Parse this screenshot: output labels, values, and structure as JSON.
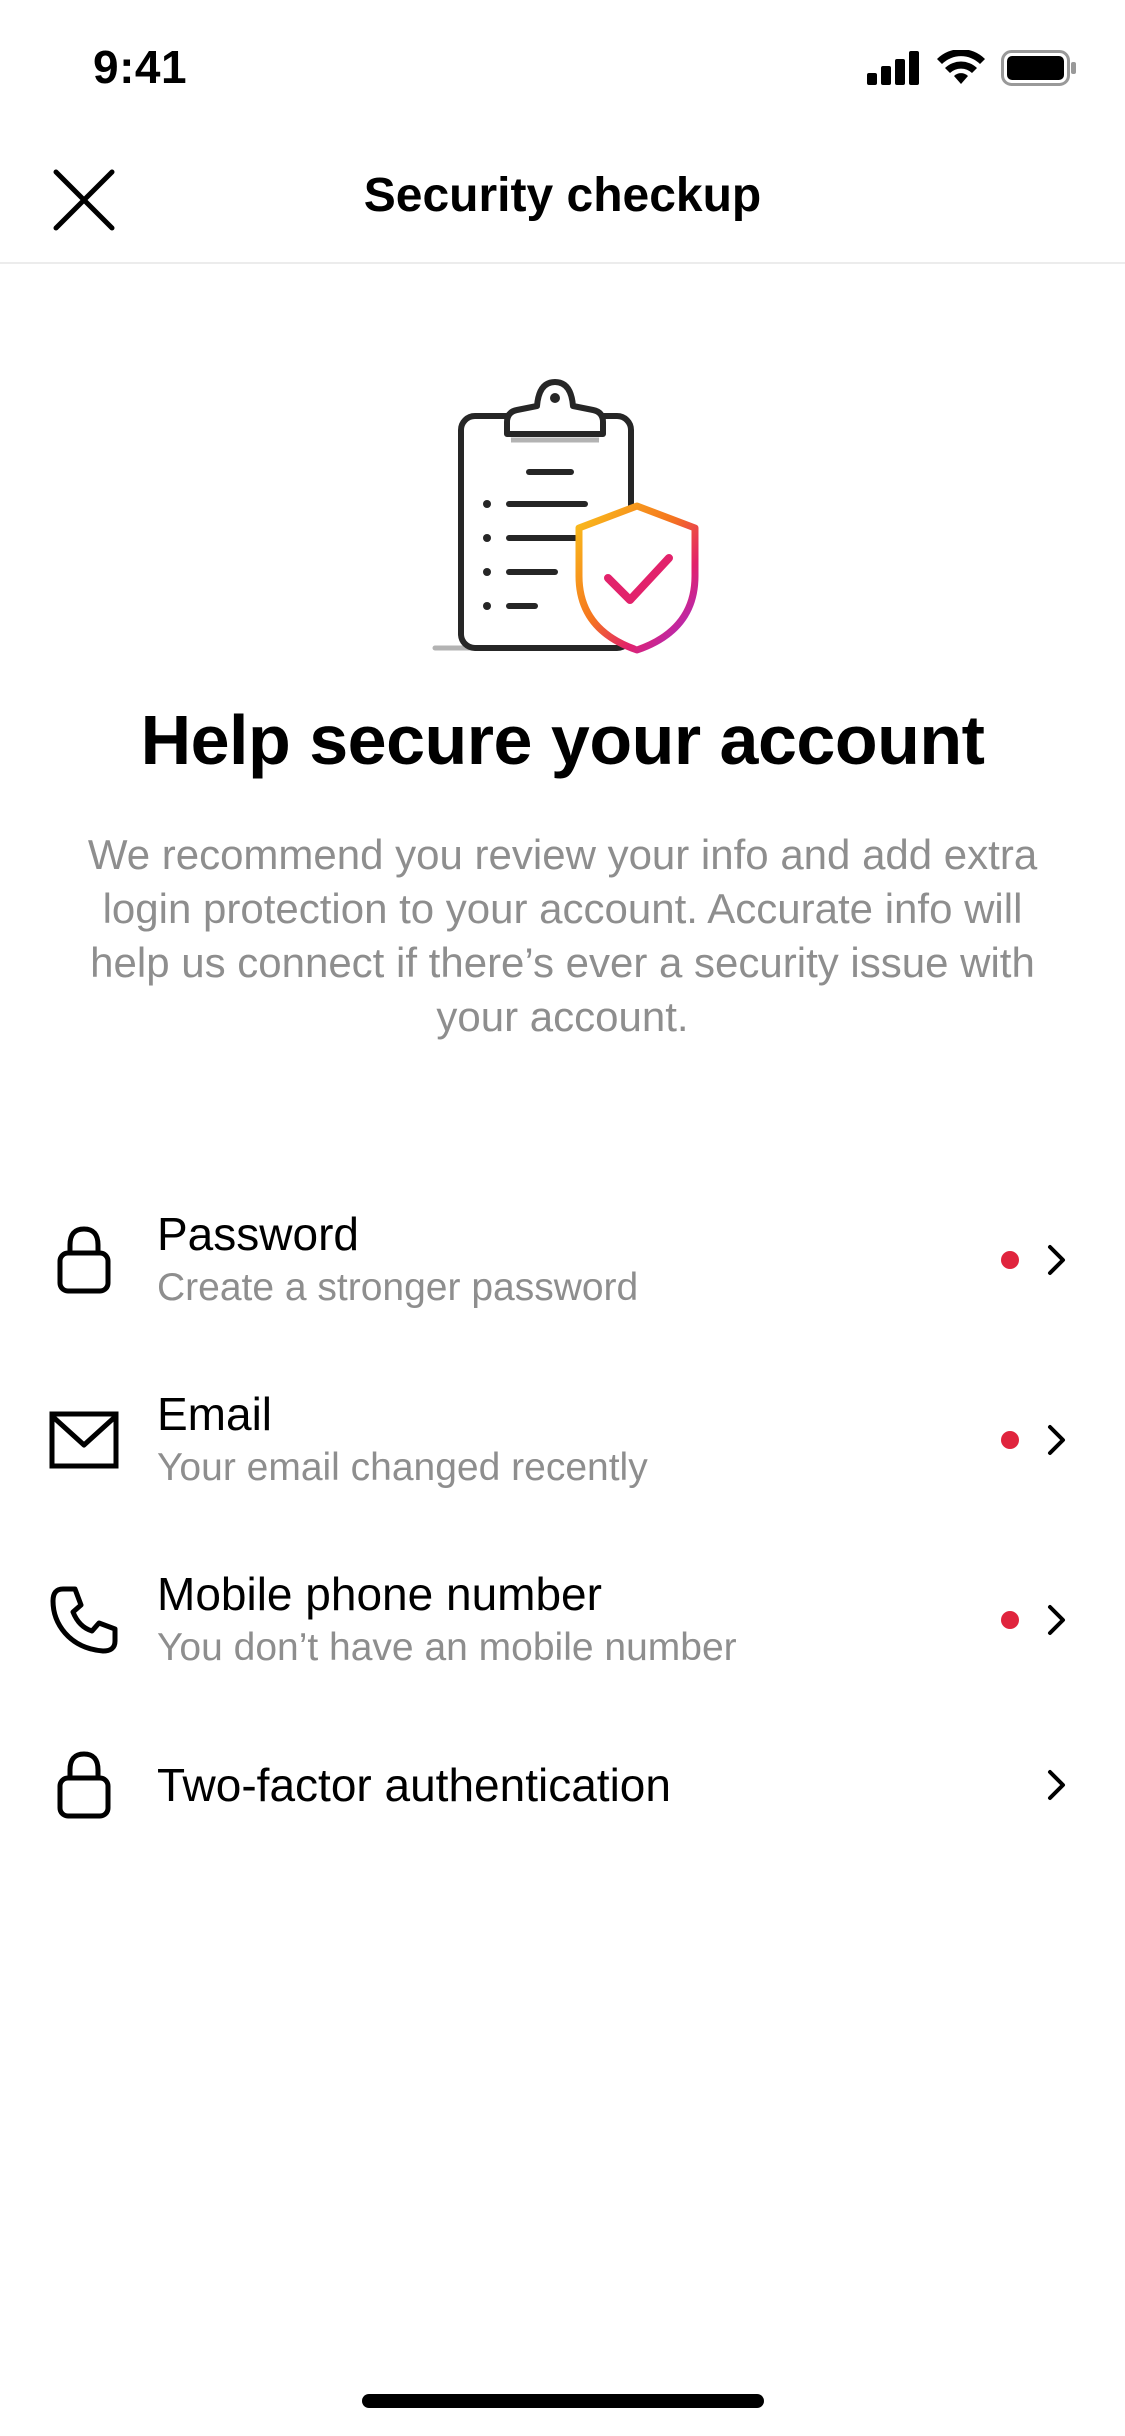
{
  "status_bar": {
    "time": "9:41",
    "icons": [
      "cellular-signal-icon",
      "wifi-icon",
      "battery-icon"
    ]
  },
  "nav": {
    "title": "Security checkup",
    "close_icon": "close-icon"
  },
  "hero": {
    "illustration": "clipboard-shield-check-icon",
    "headline": "Help secure your account",
    "description": "We recommend you review your info and add extra login protection to your account. Accurate info will help us connect if there’s ever a security issue with your account."
  },
  "items": [
    {
      "icon": "lock-icon",
      "title": "Password",
      "subtitle": "Create a stronger password",
      "alert": true
    },
    {
      "icon": "mail-icon",
      "title": "Email",
      "subtitle": "Your email changed recently",
      "alert": true
    },
    {
      "icon": "phone-icon",
      "title": "Mobile phone number",
      "subtitle": "You don’t have an mobile number",
      "alert": true
    },
    {
      "icon": "lock-icon",
      "title": "Two-factor authentication",
      "subtitle": "",
      "alert": false
    }
  ],
  "colors": {
    "alert_dot": "#e0243d",
    "secondary_text": "#8e8e8e",
    "divider": "#ececec"
  }
}
